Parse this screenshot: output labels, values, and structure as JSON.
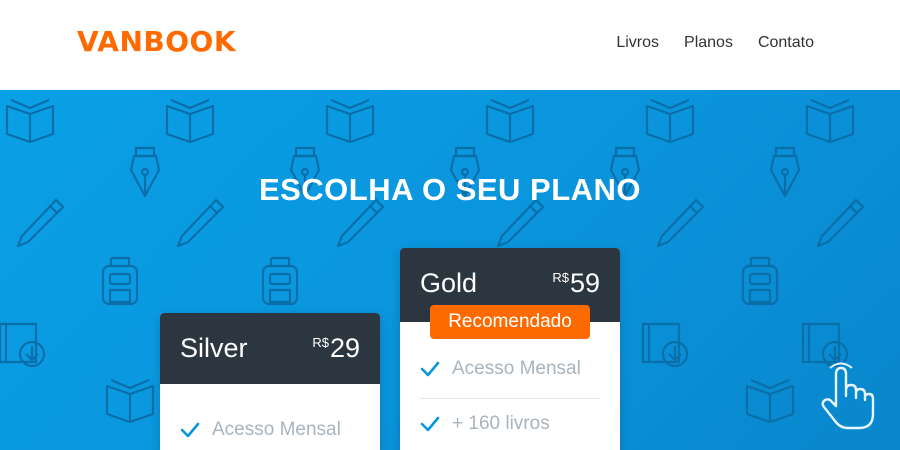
{
  "header": {
    "logo": "VANBOOK",
    "nav": [
      "Livros",
      "Planos",
      "Contato"
    ]
  },
  "hero": {
    "title": "ESCOLHA O SEU PLANO",
    "background_color": "#0a97de",
    "pattern_icons": [
      "book-icon",
      "pen-nib-icon",
      "pencil-icon",
      "backpack-icon",
      "download-book-icon"
    ]
  },
  "plans": [
    {
      "name": "Silver",
      "currency": "R$",
      "price": "29",
      "features": [
        "Acesso Mensal"
      ]
    },
    {
      "name": "Gold",
      "currency": "R$",
      "price": "59",
      "badge": "Recomendado",
      "features": [
        "Acesso Mensal",
        "+ 160 livros"
      ]
    }
  ],
  "colors": {
    "brand": "#ff6a00",
    "card_header": "#2b3640",
    "check": "#0a97de",
    "feature_text": "#a9b4bd"
  }
}
